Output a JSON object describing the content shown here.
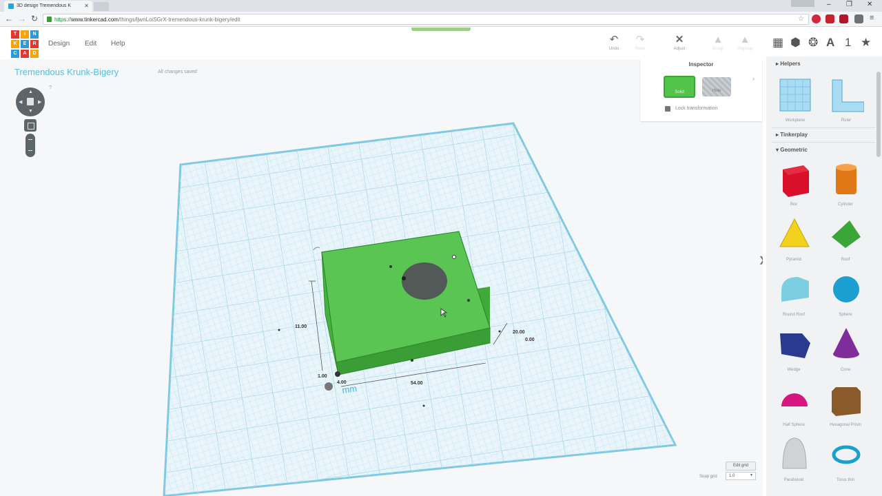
{
  "browser": {
    "tab_title": "3D design Tremendous K",
    "url_scheme": "https://",
    "url_host": "www.tinkercad.com",
    "url_path": "/things/ljwnLoiSGrX-tremendous-krunk-bigery/edit"
  },
  "app": {
    "logo_letters": [
      "T",
      "I",
      "N",
      "K",
      "E",
      "R",
      "C",
      "A",
      "D"
    ],
    "menu": [
      "Design",
      "Edit",
      "Help"
    ],
    "toolbar": [
      {
        "label": "Undo",
        "icon": "undo-icon"
      },
      {
        "label": "Redo",
        "icon": "redo-icon"
      },
      {
        "label": "Adjust",
        "icon": "adjust-icon"
      },
      {
        "label": "Group",
        "icon": "group-icon"
      },
      {
        "label": "Ungroup",
        "icon": "ungroup-icon"
      }
    ],
    "view_icons": [
      "workplane-icon",
      "box-view-icon",
      "wireframe-icon",
      "text-icon",
      "number-icon",
      "star-icon"
    ],
    "view_text": {
      "text_label": "A",
      "number_label": "1",
      "star_label": "★"
    }
  },
  "project": {
    "title": "Tremendous Krunk-Bigery",
    "status": "All changes saved"
  },
  "inspector": {
    "title": "Inspector",
    "solid_label": "Solid",
    "hole_label": "Hole",
    "lock_label": "Lock transformation",
    "solid_color": "#52c549"
  },
  "dimensions": {
    "height": "11.00",
    "depth": "20.00",
    "elevation": "0.00",
    "width": "54.00",
    "offset_x": "4.00",
    "offset_y": "1.00",
    "unit": "mm"
  },
  "snap": {
    "edit_grid_label": "Edit grid",
    "snap_label": "Snap grid",
    "snap_value": "1.0"
  },
  "sidebar": {
    "sections": [
      "Helpers",
      "Tinkerplay",
      "Geometric"
    ],
    "helpers": [
      "Workplane",
      "Ruler"
    ],
    "shapes": [
      {
        "name": "Box",
        "color": "#d8102a"
      },
      {
        "name": "Cylinder",
        "color": "#e07818"
      },
      {
        "name": "Pyramid",
        "color": "#f2d21a"
      },
      {
        "name": "Roof",
        "color": "#3aa637"
      },
      {
        "name": "Round Roof",
        "color": "#7ccfe0"
      },
      {
        "name": "Sphere",
        "color": "#1b9fd0"
      },
      {
        "name": "Wedge",
        "color": "#2a3b8f"
      },
      {
        "name": "Cone",
        "color": "#7e2d9a"
      },
      {
        "name": "Half Sphere",
        "color": "#d6157f"
      },
      {
        "name": "Hexagonal Prism",
        "color": "#8b5a2b"
      },
      {
        "name": "Paraboloid",
        "color": "#d0d2d4"
      },
      {
        "name": "Torus thin",
        "color": "#1b9fd0"
      }
    ]
  }
}
